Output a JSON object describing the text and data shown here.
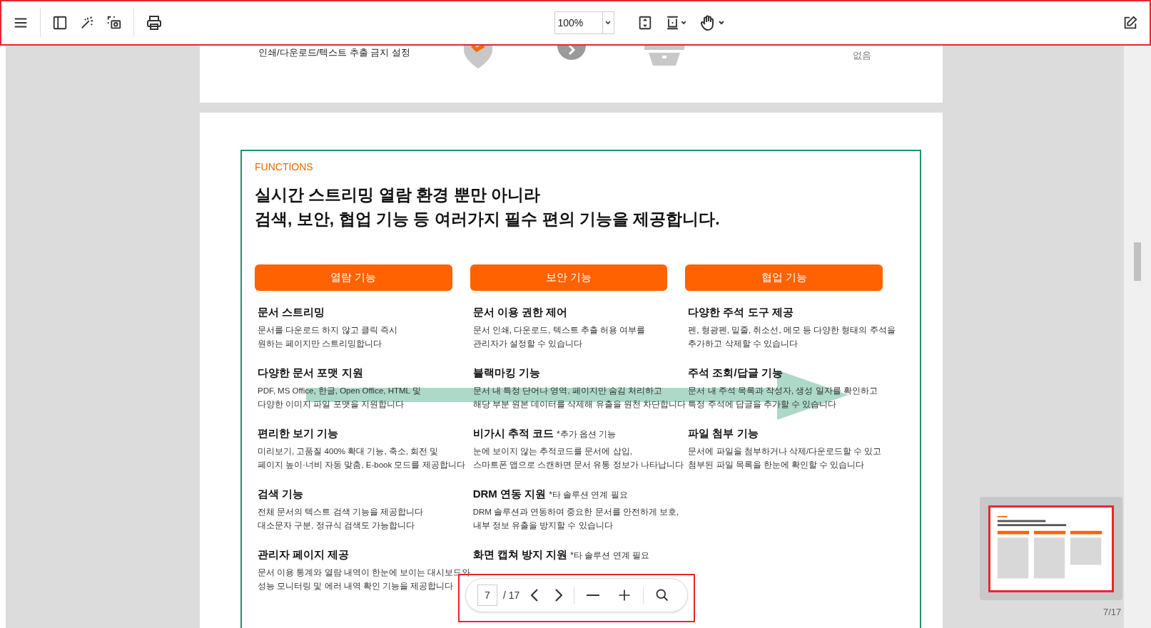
{
  "toolbar": {
    "zoom": "100%"
  },
  "prev_page": {
    "setting_text": "인쇄/다운로드/텍스트 추출 금지 설정",
    "value_text": "없음"
  },
  "page": {
    "eyebrow": "FUNCTIONS",
    "title_lines": [
      "실시간 스트리밍 열람 환경 뿐만 아니라",
      "검색, 보안, 협업 기능 등 여러가지 필수 편의 기능을 제공합니다."
    ],
    "columns": [
      {
        "header": "열람 기능",
        "items": [
          {
            "title": "문서 스트리밍",
            "lines": [
              "문서를 다운로드 하지 않고 클릭 즉시",
              "원하는 페이지만 스트리밍합니다"
            ]
          },
          {
            "title": "다양한 문서 포맷 지원",
            "lines": [
              "PDF, MS Office, 한글, Open Office, HTML 및",
              "다양한 이미지 파일 포맷을 지원합니다"
            ]
          },
          {
            "title": "편리한 보기 기능",
            "lines": [
              "미리보기, 고품질 400% 확대 기능, 축소, 회전 및",
              "페이지 높이·너비 자동 맞춤, E-book 모드를 제공합니다"
            ]
          },
          {
            "title": "검색 기능",
            "lines": [
              "전체 문서의 텍스트 검색 기능을 제공합니다",
              "대소문자 구분, 정규식 검색도 가능합니다"
            ]
          },
          {
            "title": "관리자 페이지 제공",
            "lines": [
              "문서 이용 통계와 열람 내역이 한눈에 보이는 대시보드와",
              "성능 모니터링 및 에러 내역 확인 기능을 제공합니다"
            ]
          }
        ]
      },
      {
        "header": "보안 기능",
        "items": [
          {
            "title": "문서 이용 권한 제어",
            "lines": [
              "문서 인쇄, 다운로드, 텍스트 추출 허용 여부를",
              "관리자가 설정할 수 있습니다"
            ]
          },
          {
            "title": "블랙마킹 기능",
            "lines": [
              "문서 내 특정 단어나 영역, 페이지만 숨김 처리하고",
              "해당 부분 원본 데이터를 삭제해 유출을 원천 차단합니다"
            ]
          },
          {
            "title": "비가시 추적 코드",
            "note": "*추가 옵션 기능",
            "lines": [
              "눈에 보이지 않는 추적코드를 문서에 삽입,",
              "스마트폰 앱으로 스캔하면 문서 유통 정보가 나타납니다"
            ]
          },
          {
            "title": "DRM 연동 지원",
            "note": "*타 솔루션 연계 필요",
            "lines": [
              "DRM 솔루션과 연동하여 중요한 문서를 안전하게 보호,",
              "내부 정보 유출을 방지할 수 있습니다"
            ]
          },
          {
            "title": "화면 캡쳐 방지 지원",
            "note": "*타 솔루션 연계 필요"
          }
        ]
      },
      {
        "header": "협업 기능",
        "items": [
          {
            "title": "다양한 주석 도구 제공",
            "lines": [
              "펜, 형광펜, 밑줄, 취소선, 메모 등 다양한 형태의 주석을",
              "추가하고 삭제할 수 있습니다"
            ]
          },
          {
            "title": "주석 조회/답글 기능",
            "lines": [
              "문서 내 주석 목록과 작성자, 생성 일자를 확인하고",
              "특정 주석에 답글을 추가할 수 있습니다"
            ]
          },
          {
            "title": "파일 첨부 기능",
            "lines": [
              "문서에 파일을 첨부하거나 삭제/다운로드할 수 있고",
              "첨부된 파일 목록을 한눈에 확인할 수 있습니다"
            ]
          }
        ]
      }
    ]
  },
  "pager": {
    "current": "7",
    "total": "/ 17"
  },
  "thumbnail": {
    "label": "7/17",
    "selected": true
  }
}
